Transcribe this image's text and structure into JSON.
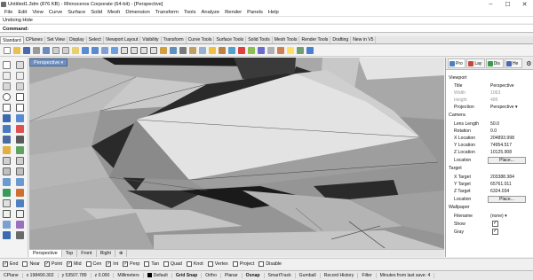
{
  "window": {
    "title": "Untitled1.3dm (876 KB) - Rhinoceros Corporate (64-bit) - [Perspective]"
  },
  "menu": [
    "File",
    "Edit",
    "View",
    "Curve",
    "Surface",
    "Solid",
    "Mesh",
    "Dimension",
    "Transform",
    "Tools",
    "Analyze",
    "Render",
    "Panels",
    "Help"
  ],
  "history_line": "Undoing Hide",
  "command": {
    "label": "Command:",
    "value": ""
  },
  "toolbar_tabs": [
    "Standard",
    "CPlanes",
    "Set View",
    "Display",
    "Select",
    "Viewport Layout",
    "Visibility",
    "Transform",
    "Curve Tools",
    "Surface Tools",
    "Solid Tools",
    "Mesh Tools",
    "Render Tools",
    "Drafting",
    "New in V5"
  ],
  "toolbar_active": "Standard",
  "viewport": {
    "label": "Perspective"
  },
  "viewport_tabs": [
    "Perspective",
    "Top",
    "Front",
    "Right",
    "⊕"
  ],
  "panel_tabs": [
    {
      "label": "Pro",
      "icon": "properties-icon",
      "color": "#4a7fc0"
    },
    {
      "label": "Lay",
      "icon": "layers-icon",
      "color": "#c04a3a"
    },
    {
      "label": "Dis",
      "icon": "display-icon",
      "color": "#3a9a4a"
    },
    {
      "label": "He",
      "icon": "help-icon",
      "color": "#4a6ab0"
    }
  ],
  "properties": {
    "viewport_header": "Viewport",
    "title_key": "Title",
    "title_val": "Perspective",
    "width_key": "Width",
    "width_val": "1063",
    "height_key": "Height",
    "height_val": "486",
    "projection_key": "Projection",
    "projection_val": "Perspective",
    "camera_header": "Camera",
    "lens_key": "Lens Length",
    "lens_val": "50.0",
    "rotation_key": "Rotation",
    "rotation_val": "0.0",
    "xloc_key": "X Location",
    "xloc_val": "204893.998",
    "yloc_key": "Y Location",
    "yloc_val": "74954.517",
    "zloc_key": "Z Location",
    "zloc_val": "10125.908",
    "location_key": "Location",
    "place_label": "Place...",
    "target_header": "Target",
    "xt_key": "X Target",
    "xt_val": "203388.384",
    "yt_key": "Y Target",
    "yt_val": "65761.011",
    "zt_key": "Z Target",
    "zt_val": "6324.034",
    "tloc_key": "Location",
    "tplace_label": "Place...",
    "wallpaper_header": "Wallpaper",
    "filename_key": "Filename",
    "filename_val": "(none)",
    "show_key": "Show",
    "show_check": "✓",
    "gray_key": "Gray",
    "gray_check": "✓"
  },
  "osnaps": [
    {
      "label": "End",
      "checked": true
    },
    {
      "label": "Near",
      "checked": false
    },
    {
      "label": "Point",
      "checked": true
    },
    {
      "label": "Mid",
      "checked": true
    },
    {
      "label": "Cen",
      "checked": false
    },
    {
      "label": "Int",
      "checked": true
    },
    {
      "label": "Perp",
      "checked": true
    },
    {
      "label": "Tan",
      "checked": false
    },
    {
      "label": "Quad",
      "checked": false
    },
    {
      "label": "Knot",
      "checked": false
    },
    {
      "label": "Vertex",
      "checked": false
    },
    {
      "label": "Project",
      "checked": false
    },
    {
      "label": "Disable",
      "checked": false
    }
  ],
  "status": {
    "cplane": "CPlane",
    "x": "x 198490.302",
    "y": "y 53507.789",
    "z": "z 0.000",
    "units": "Millimeters",
    "layer": "Default",
    "grid_snap": "Grid Snap",
    "ortho": "Ortho",
    "planar": "Planar",
    "osnap": "Osnap",
    "smarttrack": "SmartTrack",
    "gumball": "Gumball",
    "record_history": "Record History",
    "filter": "Filter",
    "message": "Minutes from last save: 4"
  }
}
